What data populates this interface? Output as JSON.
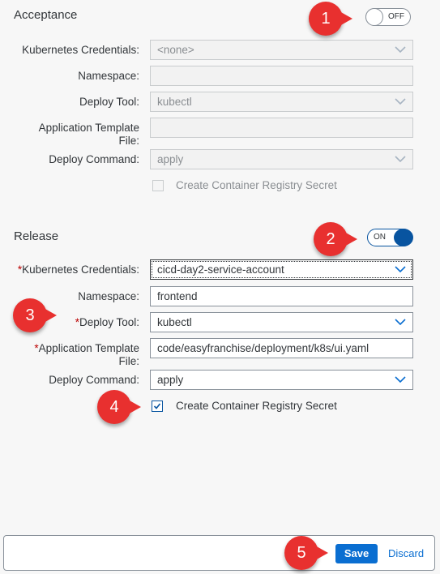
{
  "acceptance": {
    "title": "Acceptance",
    "toggle_label": "OFF",
    "credentials_label": "Kubernetes Credentials:",
    "credentials_value": "<none>",
    "namespace_label": "Namespace:",
    "namespace_value": "",
    "deploy_tool_label": "Deploy Tool:",
    "deploy_tool_value": "kubectl",
    "template_label_1": "Application Template",
    "template_label_2": "File:",
    "template_value": "",
    "deploy_command_label": "Deploy Command:",
    "deploy_command_value": "apply",
    "registry_secret_label": "Create Container Registry Secret",
    "registry_secret_checked": false
  },
  "release": {
    "title": "Release",
    "toggle_label": "ON",
    "required_mark": "*",
    "credentials_label": "Kubernetes Credentials:",
    "credentials_value": "cicd-day2-service-account",
    "namespace_label": "Namespace:",
    "namespace_value": "frontend",
    "deploy_tool_label": "Deploy Tool:",
    "deploy_tool_value": "kubectl",
    "template_label_1": "Application Template",
    "template_label_2": "File:",
    "template_value": "code/easyfranchise/deployment/k8s/ui.yaml",
    "deploy_command_label": "Deploy Command:",
    "deploy_command_value": "apply",
    "registry_secret_label": "Create Container Registry Secret",
    "registry_secret_checked": true
  },
  "footer": {
    "save_label": "Save",
    "discard_label": "Discard"
  },
  "callouts": [
    "1",
    "2",
    "3",
    "4",
    "5"
  ],
  "colors": {
    "accent": "#0a6ed1",
    "toggle_on": "#0854a0",
    "callout": "#e8302f",
    "required": "#bb0000"
  }
}
